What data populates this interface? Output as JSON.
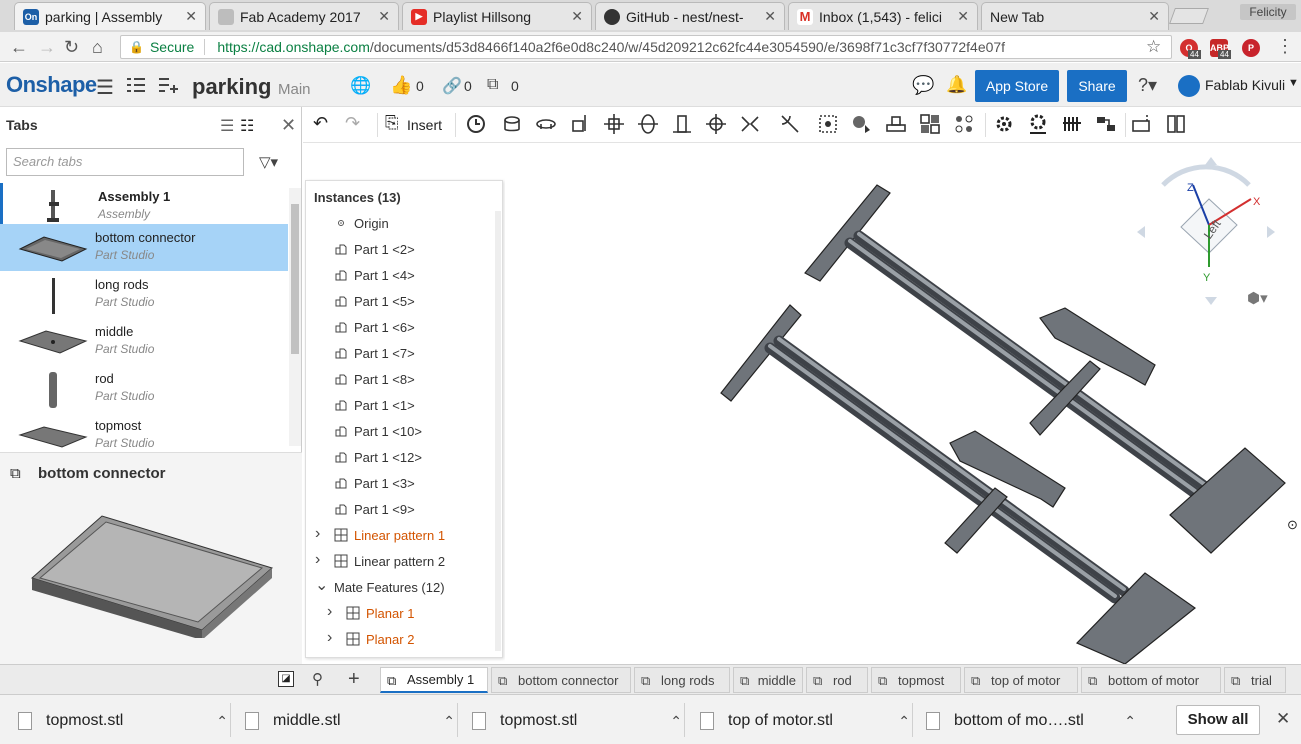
{
  "browser": {
    "tabs": [
      {
        "title": "parking | Assembly",
        "favicon": "On",
        "fav_color": "#1d5fa7"
      },
      {
        "title": "Fab Academy 2017",
        "favicon": "",
        "fav_color": "#9e9e9e"
      },
      {
        "title": "Playlist Hillsong",
        "favicon": "▶",
        "fav_color": "#e52d27"
      },
      {
        "title": "GitHub - nest/nest-",
        "favicon": "",
        "fav_color": "#333333"
      },
      {
        "title": "Inbox (1,543) - felici",
        "favicon": "M",
        "fav_color": "#d93025"
      },
      {
        "title": "New Tab",
        "favicon": "",
        "fav_color": "#e6e6e6"
      }
    ],
    "profile": "Felicity",
    "secure_label": "Secure",
    "url_host": "https://cad.onshape.com",
    "url_path": "/documents/d53d8466f140a2f6e0d8c240/w/45d209212c62fc44e3054590/e/3698f71c3cf7f30772f4e07f",
    "ext_badges": [
      "44",
      "44"
    ]
  },
  "onshape": {
    "logo": "Onshape",
    "doc_name": "parking",
    "branch": "Main",
    "likes": "0",
    "links": "0",
    "copies": "0",
    "app_store": "App Store",
    "share": "Share",
    "user": "Fablab Kivuli"
  },
  "left": {
    "title": "Tabs",
    "search_placeholder": "Search tabs",
    "items": [
      {
        "name": "Assembly 1",
        "type": "Assembly"
      },
      {
        "name": "bottom connector",
        "type": "Part Studio"
      },
      {
        "name": "long rods",
        "type": "Part Studio"
      },
      {
        "name": "middle",
        "type": "Part Studio"
      },
      {
        "name": "rod",
        "type": "Part Studio"
      },
      {
        "name": "topmost",
        "type": "Part Studio"
      }
    ],
    "preview_title": "bottom connector"
  },
  "toolbar": {
    "insert_label": "Insert"
  },
  "instances": {
    "title": "Instances (13)",
    "items": [
      {
        "label": "Origin",
        "kind": "origin"
      },
      {
        "label": "Part 1 <2>",
        "kind": "part"
      },
      {
        "label": "Part 1 <4>",
        "kind": "part"
      },
      {
        "label": "Part 1 <5>",
        "kind": "part"
      },
      {
        "label": "Part 1 <6>",
        "kind": "part"
      },
      {
        "label": "Part 1 <7>",
        "kind": "part"
      },
      {
        "label": "Part 1 <8>",
        "kind": "part"
      },
      {
        "label": "Part 1 <1>",
        "kind": "part"
      },
      {
        "label": "Part 1 <10>",
        "kind": "part"
      },
      {
        "label": "Part 1 <12>",
        "kind": "part"
      },
      {
        "label": "Part 1 <3>",
        "kind": "part"
      },
      {
        "label": "Part 1 <9>",
        "kind": "part"
      },
      {
        "label": "Linear pattern 1",
        "kind": "pattern"
      },
      {
        "label": "Linear pattern 2",
        "kind": "pattern"
      },
      {
        "label": "Mate Features (12)",
        "kind": "group"
      },
      {
        "label": "Planar 1",
        "kind": "mate"
      },
      {
        "label": "Planar 2",
        "kind": "mate"
      }
    ]
  },
  "viewcube": {
    "face": "Left",
    "axis_x": "X",
    "axis_y": "Y",
    "axis_z": "Z"
  },
  "doctabs": [
    "Assembly 1",
    "bottom connector",
    "long rods",
    "middle",
    "rod",
    "topmost",
    "top of motor",
    "bottom of motor",
    "trial"
  ],
  "downloads": {
    "files": [
      "topmost.stl",
      "middle.stl",
      "topmost.stl",
      "top of motor.stl",
      "bottom of mo….stl"
    ],
    "show_all": "Show all"
  }
}
